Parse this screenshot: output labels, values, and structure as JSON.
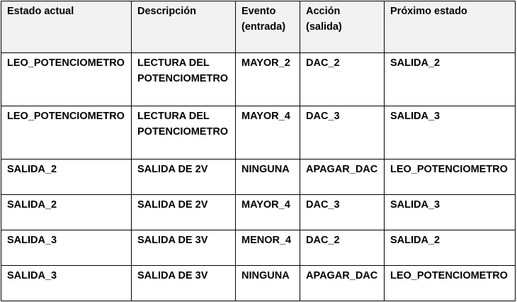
{
  "table": {
    "headers": [
      "Estado actual",
      "Descripción",
      "Evento\n(entrada)",
      "Acción\n(salida)",
      "Próximo estado"
    ],
    "rows": [
      [
        "LEO_POTENCIOMETRO",
        "LECTURA DEL\nPOTENCIOMETRO",
        "MAYOR_2",
        "DAC_2",
        "SALIDA_2"
      ],
      [
        "LEO_POTENCIOMETRO",
        "LECTURA DEL\nPOTENCIOMETRO",
        "MAYOR_4",
        "DAC_3",
        "SALIDA_3"
      ],
      [
        "SALIDA_2",
        "SALIDA DE 2V",
        "NINGUNA",
        "APAGAR_DAC",
        "LEO_POTENCIOMETRO"
      ],
      [
        "SALIDA_2",
        "SALIDA DE 2V",
        "MAYOR_4",
        "DAC_3",
        "SALIDA_3"
      ],
      [
        "SALIDA_3",
        "SALIDA DE 3V",
        "MENOR_4",
        "DAC_2",
        "SALIDA_2"
      ],
      [
        "SALIDA_3",
        "SALIDA DE 3V",
        "NINGUNA",
        "APAGAR_DAC",
        "LEO_POTENCIOMETRO"
      ]
    ]
  }
}
